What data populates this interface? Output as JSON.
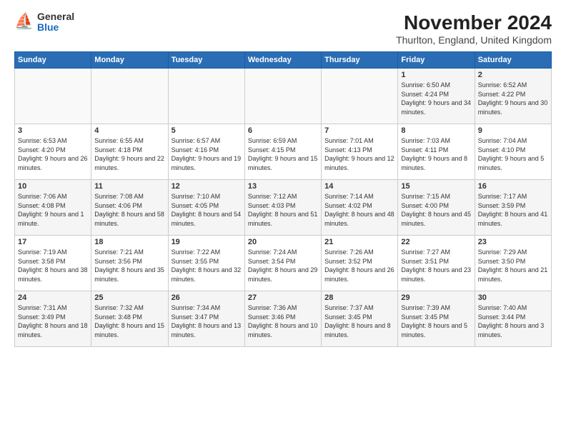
{
  "logo": {
    "general": "General",
    "blue": "Blue"
  },
  "header": {
    "month": "November 2024",
    "location": "Thurlton, England, United Kingdom"
  },
  "weekdays": [
    "Sunday",
    "Monday",
    "Tuesday",
    "Wednesday",
    "Thursday",
    "Friday",
    "Saturday"
  ],
  "weeks": [
    [
      {
        "day": "",
        "info": ""
      },
      {
        "day": "",
        "info": ""
      },
      {
        "day": "",
        "info": ""
      },
      {
        "day": "",
        "info": ""
      },
      {
        "day": "",
        "info": ""
      },
      {
        "day": "1",
        "info": "Sunrise: 6:50 AM\nSunset: 4:24 PM\nDaylight: 9 hours\nand 34 minutes."
      },
      {
        "day": "2",
        "info": "Sunrise: 6:52 AM\nSunset: 4:22 PM\nDaylight: 9 hours\nand 30 minutes."
      }
    ],
    [
      {
        "day": "3",
        "info": "Sunrise: 6:53 AM\nSunset: 4:20 PM\nDaylight: 9 hours\nand 26 minutes."
      },
      {
        "day": "4",
        "info": "Sunrise: 6:55 AM\nSunset: 4:18 PM\nDaylight: 9 hours\nand 22 minutes."
      },
      {
        "day": "5",
        "info": "Sunrise: 6:57 AM\nSunset: 4:16 PM\nDaylight: 9 hours\nand 19 minutes."
      },
      {
        "day": "6",
        "info": "Sunrise: 6:59 AM\nSunset: 4:15 PM\nDaylight: 9 hours\nand 15 minutes."
      },
      {
        "day": "7",
        "info": "Sunrise: 7:01 AM\nSunset: 4:13 PM\nDaylight: 9 hours\nand 12 minutes."
      },
      {
        "day": "8",
        "info": "Sunrise: 7:03 AM\nSunset: 4:11 PM\nDaylight: 9 hours\nand 8 minutes."
      },
      {
        "day": "9",
        "info": "Sunrise: 7:04 AM\nSunset: 4:10 PM\nDaylight: 9 hours\nand 5 minutes."
      }
    ],
    [
      {
        "day": "10",
        "info": "Sunrise: 7:06 AM\nSunset: 4:08 PM\nDaylight: 9 hours\nand 1 minute."
      },
      {
        "day": "11",
        "info": "Sunrise: 7:08 AM\nSunset: 4:06 PM\nDaylight: 8 hours\nand 58 minutes."
      },
      {
        "day": "12",
        "info": "Sunrise: 7:10 AM\nSunset: 4:05 PM\nDaylight: 8 hours\nand 54 minutes."
      },
      {
        "day": "13",
        "info": "Sunrise: 7:12 AM\nSunset: 4:03 PM\nDaylight: 8 hours\nand 51 minutes."
      },
      {
        "day": "14",
        "info": "Sunrise: 7:14 AM\nSunset: 4:02 PM\nDaylight: 8 hours\nand 48 minutes."
      },
      {
        "day": "15",
        "info": "Sunrise: 7:15 AM\nSunset: 4:00 PM\nDaylight: 8 hours\nand 45 minutes."
      },
      {
        "day": "16",
        "info": "Sunrise: 7:17 AM\nSunset: 3:59 PM\nDaylight: 8 hours\nand 41 minutes."
      }
    ],
    [
      {
        "day": "17",
        "info": "Sunrise: 7:19 AM\nSunset: 3:58 PM\nDaylight: 8 hours\nand 38 minutes."
      },
      {
        "day": "18",
        "info": "Sunrise: 7:21 AM\nSunset: 3:56 PM\nDaylight: 8 hours\nand 35 minutes."
      },
      {
        "day": "19",
        "info": "Sunrise: 7:22 AM\nSunset: 3:55 PM\nDaylight: 8 hours\nand 32 minutes."
      },
      {
        "day": "20",
        "info": "Sunrise: 7:24 AM\nSunset: 3:54 PM\nDaylight: 8 hours\nand 29 minutes."
      },
      {
        "day": "21",
        "info": "Sunrise: 7:26 AM\nSunset: 3:52 PM\nDaylight: 8 hours\nand 26 minutes."
      },
      {
        "day": "22",
        "info": "Sunrise: 7:27 AM\nSunset: 3:51 PM\nDaylight: 8 hours\nand 23 minutes."
      },
      {
        "day": "23",
        "info": "Sunrise: 7:29 AM\nSunset: 3:50 PM\nDaylight: 8 hours\nand 21 minutes."
      }
    ],
    [
      {
        "day": "24",
        "info": "Sunrise: 7:31 AM\nSunset: 3:49 PM\nDaylight: 8 hours\nand 18 minutes."
      },
      {
        "day": "25",
        "info": "Sunrise: 7:32 AM\nSunset: 3:48 PM\nDaylight: 8 hours\nand 15 minutes."
      },
      {
        "day": "26",
        "info": "Sunrise: 7:34 AM\nSunset: 3:47 PM\nDaylight: 8 hours\nand 13 minutes."
      },
      {
        "day": "27",
        "info": "Sunrise: 7:36 AM\nSunset: 3:46 PM\nDaylight: 8 hours\nand 10 minutes."
      },
      {
        "day": "28",
        "info": "Sunrise: 7:37 AM\nSunset: 3:45 PM\nDaylight: 8 hours\nand 8 minutes."
      },
      {
        "day": "29",
        "info": "Sunrise: 7:39 AM\nSunset: 3:45 PM\nDaylight: 8 hours\nand 5 minutes."
      },
      {
        "day": "30",
        "info": "Sunrise: 7:40 AM\nSunset: 3:44 PM\nDaylight: 8 hours\nand 3 minutes."
      }
    ]
  ]
}
